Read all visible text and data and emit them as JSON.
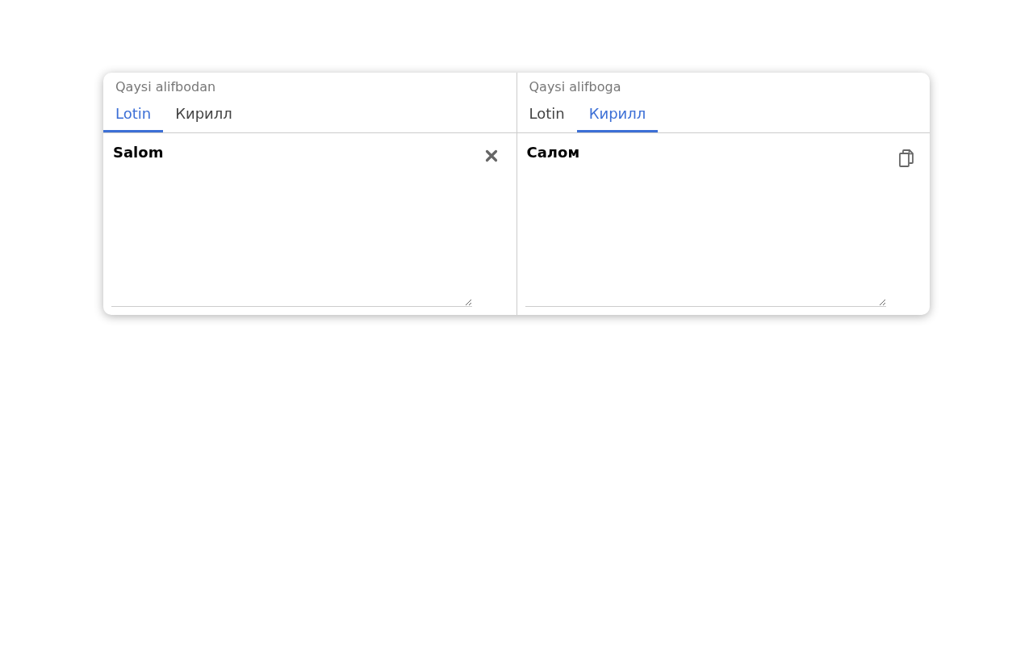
{
  "panels": [
    {
      "label": "Qaysi alifbodan",
      "tabs": [
        {
          "label": "Lotin",
          "selected": true
        },
        {
          "label": "Кирилл",
          "selected": false
        }
      ],
      "text": "Salom",
      "kind": "clear"
    },
    {
      "label": "Qaysi alifboga",
      "tabs": [
        {
          "label": "Lotin",
          "selected": false
        },
        {
          "label": "Кирилл",
          "selected": true
        }
      ],
      "text": "Салом",
      "kind": "copy"
    }
  ]
}
